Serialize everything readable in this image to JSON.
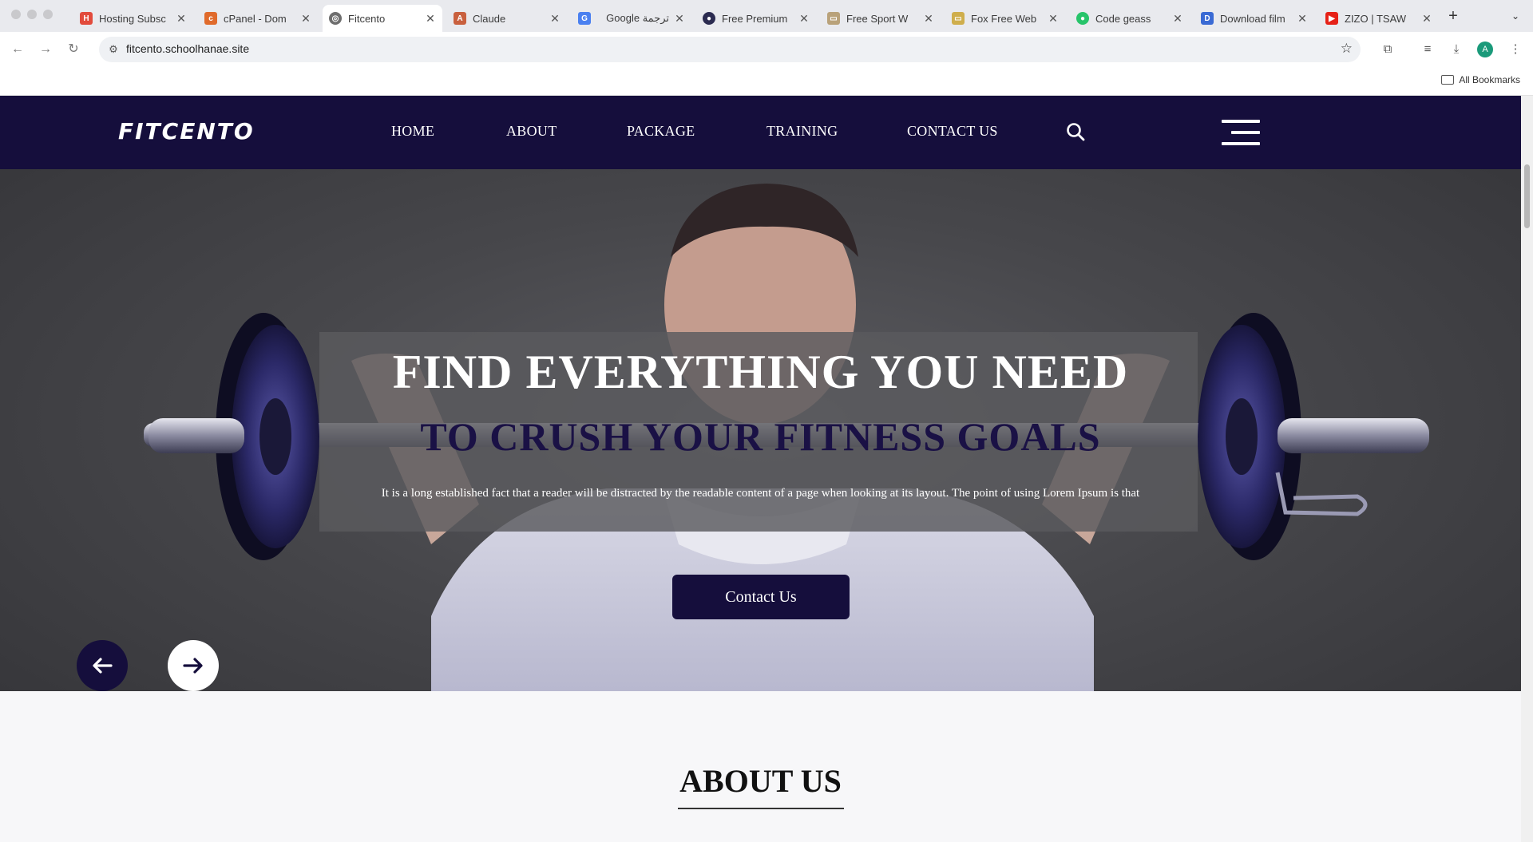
{
  "browser": {
    "tabs": [
      {
        "title": "Hosting Subsc",
        "favicon_color": "#e24b3c",
        "favicon_glyph": "H"
      },
      {
        "title": "cPanel - Dom",
        "favicon_color": "#e06a2b",
        "favicon_glyph": "c"
      },
      {
        "title": "Fitcento",
        "favicon_color": "#6e6e6e",
        "favicon_glyph": "◎",
        "active": true
      },
      {
        "title": "Claude",
        "favicon_color": "#c9603e",
        "favicon_glyph": "A"
      },
      {
        "title": "Google ترجمة",
        "favicon_color": "#4a80f0",
        "favicon_glyph": "G"
      },
      {
        "title": "Free Premium",
        "favicon_color": "#2b2b50",
        "favicon_glyph": "●"
      },
      {
        "title": "Free Sport W",
        "favicon_color": "#b9a27a",
        "favicon_glyph": "▭"
      },
      {
        "title": "Fox Free Web",
        "favicon_color": "#cfae4c",
        "favicon_glyph": "▭"
      },
      {
        "title": "Code geass",
        "favicon_color": "#27c46a",
        "favicon_glyph": "●"
      },
      {
        "title": "Download film",
        "favicon_color": "#3a6ad4",
        "favicon_glyph": "D"
      },
      {
        "title": "ZIZO | TSAW",
        "favicon_color": "#e62117",
        "favicon_glyph": "▶"
      }
    ],
    "url": "fitcento.schoolhanae.site",
    "bookmarks_label": "All Bookmarks",
    "profile_initial": "A"
  },
  "site": {
    "logo": "Fitcento",
    "nav": [
      "HOME",
      "ABOUT",
      "PACKAGE",
      "TRAINING",
      "CONTACT US"
    ],
    "brand_color": "#150e3c",
    "hero": {
      "heading": "FIND EVERYTHING YOU NEED",
      "subheading": "TO CRUSH YOUR FITNESS GOALS",
      "description": "It is a long established fact that a reader will be distracted by the readable content of a page when looking at its layout. The point of using Lorem Ipsum is that",
      "cta_label": "Contact Us"
    },
    "about": {
      "title": "ABOUT US"
    }
  }
}
